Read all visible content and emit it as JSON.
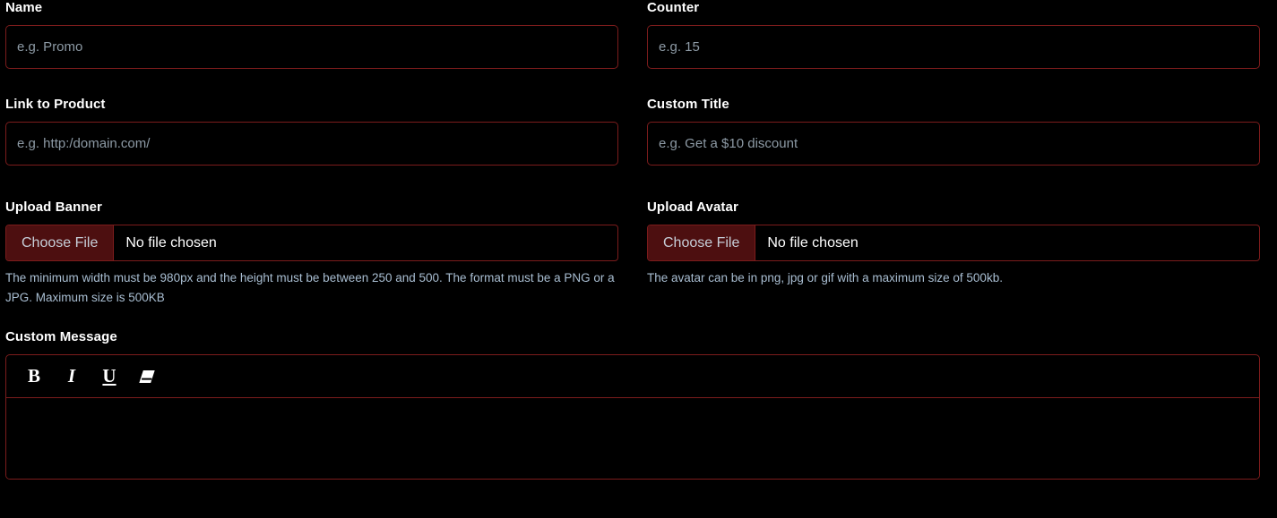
{
  "form": {
    "rows": [
      {
        "fields": [
          {
            "id": "name",
            "label": "Name",
            "placeholder": "e.g. Promo",
            "value": ""
          },
          {
            "id": "counter",
            "label": "Counter",
            "placeholder": "e.g. 15",
            "value": ""
          }
        ]
      },
      {
        "fields": [
          {
            "id": "link_to_product",
            "label": "Link to Product",
            "placeholder": "e.g. http:/domain.com/",
            "value": ""
          },
          {
            "id": "custom_title",
            "label": "Custom Title",
            "placeholder": "e.g. Get a $10 discount",
            "value": ""
          }
        ]
      }
    ],
    "uploads": [
      {
        "id": "upload_banner",
        "label": "Upload Banner",
        "button_label": "Choose File",
        "status": "No file chosen",
        "help": "The minimum width must be 980px and the height must be between 250 and 500. The format must be a PNG or a JPG. Maximum size is 500KB"
      },
      {
        "id": "upload_avatar",
        "label": "Upload Avatar",
        "button_label": "Choose File",
        "status": "No file chosen",
        "help": "The avatar can be in png, jpg or gif with a maximum size of 500kb."
      }
    ],
    "custom_message": {
      "label": "Custom Message",
      "toolbar": [
        {
          "icon": "bold-icon",
          "glyph": "B",
          "style": "bold",
          "title": "Bold"
        },
        {
          "icon": "italic-icon",
          "glyph": "I",
          "style": "italic",
          "title": "Italic"
        },
        {
          "icon": "underline-icon",
          "glyph": "U",
          "style": "underline",
          "title": "Underline"
        },
        {
          "icon": "eraser-icon",
          "glyph": "",
          "style": "eraser",
          "title": "Remove Formatting"
        }
      ],
      "content": ""
    }
  },
  "colors": {
    "background": "#000000",
    "border": "#7c1c1c",
    "button_fill": "#4d0f10",
    "button_text": "#c6ced8",
    "label_text": "#ffffff",
    "placeholder_text": "#8d9aa5",
    "help_text": "#a9bed2"
  }
}
